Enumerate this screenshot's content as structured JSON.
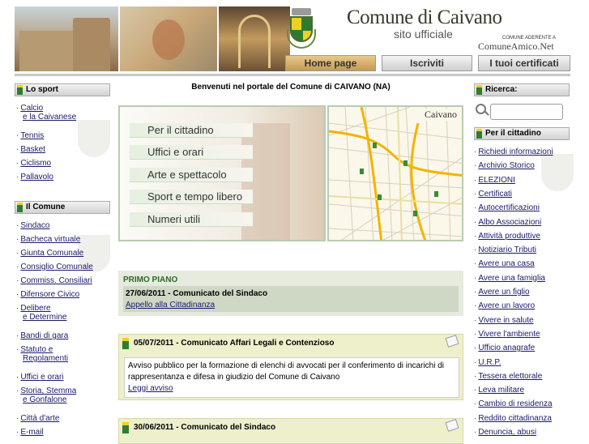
{
  "header": {
    "title": "Comune di Caivano",
    "subtitle": "sito ufficiale",
    "comune_amico_caption": "COMUNE ADERENTE A",
    "comune_amico_name": "ComuneAmico.Net",
    "nav": [
      "Home page",
      "Iscriviti",
      "I tuoi certificati"
    ]
  },
  "left": {
    "sport": {
      "heading": "Lo sport",
      "items": [
        [
          "Calcio",
          "e la Caivanese"
        ],
        [
          "Tennis"
        ],
        [
          "Basket"
        ],
        [
          "Ciclismo"
        ],
        [
          "Pallavolo"
        ]
      ]
    },
    "comune": {
      "heading": "Il Comune",
      "items": [
        [
          "Sindaco"
        ],
        [
          "Bacheca virtuale"
        ],
        [
          "Giunta Comunale"
        ],
        [
          "Consiglio Comunale"
        ],
        [
          "Commiss. Consiliari"
        ],
        [
          "Difensore Civico"
        ],
        [
          "Delibere",
          "e Determine"
        ],
        [
          "Bandi di gara"
        ],
        [
          "Statuto e",
          "Regolamenti"
        ],
        [
          "Uffici e orari"
        ],
        [
          "Storia, Stemma",
          "e Gonfalone"
        ],
        [
          "Città d'arte"
        ],
        [
          "E-mail"
        ]
      ]
    }
  },
  "main": {
    "welcome": "Benvenuti nel portale del Comune di CAIVANO (NA)",
    "menu": [
      "Per il cittadino",
      "Uffici e orari",
      "Arte e spettacolo",
      "Sport e tempo libero",
      "Numeri utili"
    ],
    "map_label": "Caivano",
    "primo_piano": {
      "heading": "PRIMO PIANO",
      "title": "27/06/2011 - Comunicato del Sindaco",
      "link": "Appello alla Cittadinanza"
    },
    "news": [
      {
        "title": "05/07/2011 - Comunicato Affari Legali e Contenzioso",
        "body": "Avviso pubblico per la formazione di elenchi di avvocati per il conferimento di incarichi di rappresentanza e difesa in giudizio del Comune di Caivano",
        "link": "Leggi avviso"
      },
      {
        "title": "30/06/2011 - Comunicato del Sindaco"
      }
    ]
  },
  "right": {
    "search_heading": "Ricerca:",
    "search_value": "",
    "cittadino": {
      "heading": "Per il cittadino",
      "items": [
        "Richiedi informazioni",
        "Archivio Storico",
        "ELEZIONI",
        "Certificati",
        "Autocertificazioni",
        "Albo Associazioni",
        "Attività produttive",
        "Notiziario Tributi",
        "Avere una casa",
        "Avere una famiglia",
        "Avere un figlio",
        "Avere un lavoro",
        "Vivere in salute",
        "Vivere l'ambiente",
        "Ufficio anagrafe",
        "U.R.P.",
        "Tessera elettorale",
        "Leva militare",
        "Cambio di residenza",
        "Reddito cittadinanza",
        "Denuncia, abusi"
      ]
    }
  },
  "colors": {
    "link": "#1a1a6a",
    "accent_green": "#2e7d32",
    "primo_green": "#2a6a2a",
    "news_bg": "#eef0cc"
  }
}
